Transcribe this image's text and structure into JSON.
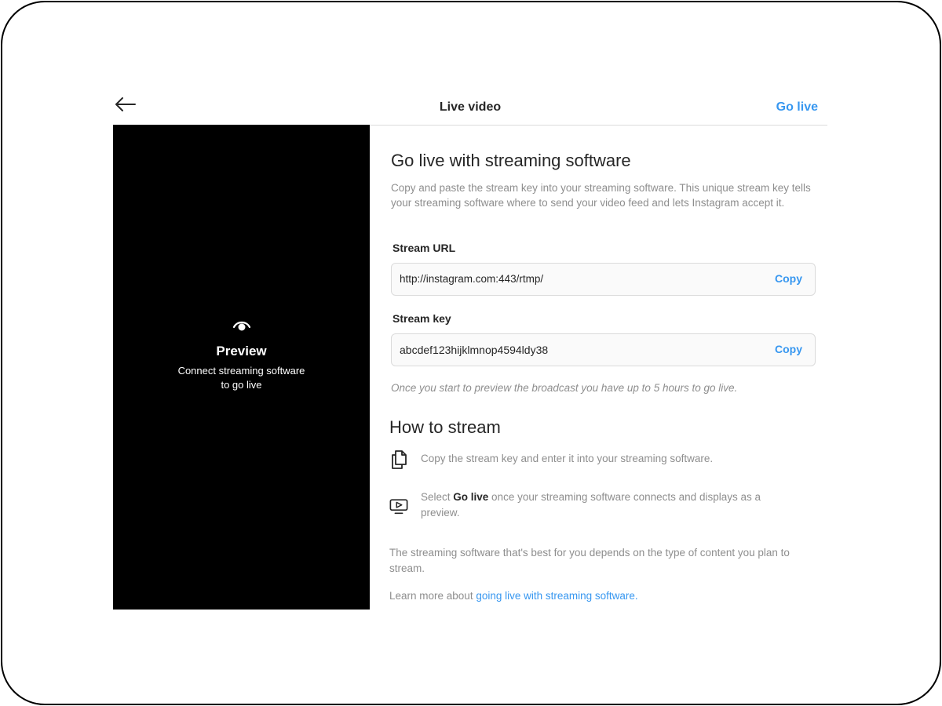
{
  "header": {
    "back_icon": "arrow-left-icon",
    "title": "Live video",
    "go_live_label": "Go live"
  },
  "preview": {
    "icon": "eye-icon",
    "title": "Preview",
    "subtitle": "Connect streaming software\nto go live"
  },
  "main": {
    "heading": "Go live with streaming software",
    "description": "Copy and paste the stream key into your streaming software. This unique stream key tells your streaming software where to send your video feed and lets Instagram accept it.",
    "stream_url": {
      "label": "Stream URL",
      "value": "http://instagram.com:443/rtmp/",
      "copy_label": "Copy"
    },
    "stream_key": {
      "label": "Stream key",
      "value": "abcdef123hijklmnop4594ldy38",
      "copy_label": "Copy"
    },
    "note": "Once you start to preview the broadcast you have up to 5 hours to go live.",
    "how_to": {
      "heading": "How to stream",
      "steps": [
        {
          "icon": "copy-icon",
          "text": "Copy the stream key and enter it into your streaming software."
        },
        {
          "icon": "monitor-play-icon",
          "prefix": "Select ",
          "bold": "Go live",
          "suffix": " once your streaming software connects and displays as a preview."
        }
      ]
    },
    "footer_text": "The streaming software that's best for you depends on the type of content you plan to stream.",
    "learn_prefix": "Learn more about ",
    "learn_link": "going live with streaming software."
  },
  "colors": {
    "accent": "#3797f0",
    "text_primary": "#262626",
    "text_secondary": "#8e8e8e",
    "preview_bg": "#000000"
  }
}
